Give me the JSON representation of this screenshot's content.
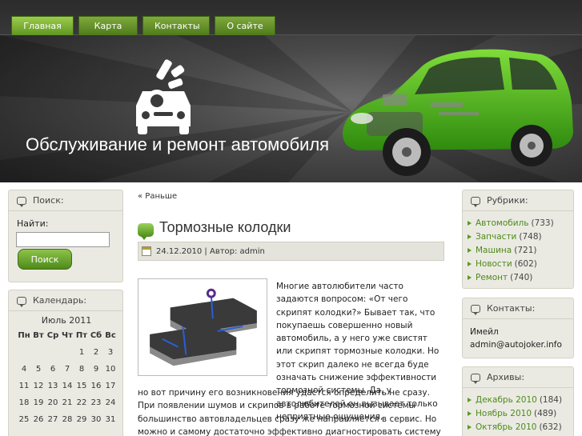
{
  "nav": {
    "items": [
      {
        "label": "Главная"
      },
      {
        "label": "Карта"
      },
      {
        "label": "Контакты"
      },
      {
        "label": "О сайте"
      }
    ]
  },
  "header": {
    "site_title": "Обслуживание и ремонт автомобиля"
  },
  "sidebar_left": {
    "search": {
      "title": "Поиск:",
      "label": "Найти:",
      "input_value": "",
      "button_label": "Поиск"
    },
    "calendar": {
      "title": "Календарь:",
      "month": "Июль 2011",
      "weekdays": [
        "Пн",
        "Вт",
        "Ср",
        "Чт",
        "Пт",
        "Сб",
        "Вс"
      ],
      "weeks": [
        [
          "",
          "",
          "",
          "",
          "1",
          "2",
          "3"
        ],
        [
          "4",
          "5",
          "6",
          "7",
          "8",
          "9",
          "10"
        ],
        [
          "11",
          "12",
          "13",
          "14",
          "15",
          "16",
          "17"
        ],
        [
          "18",
          "19",
          "20",
          "21",
          "22",
          "23",
          "24"
        ],
        [
          "25",
          "26",
          "27",
          "28",
          "29",
          "30",
          "31"
        ]
      ]
    }
  },
  "main": {
    "prev_link": "« Раньше",
    "post": {
      "title": "Тормозные колодки",
      "meta": "24.12.2010 | Автор: admin",
      "text_right": "Многие автолюбители часто задаются вопросом: «От чего скрипят колодки?» Бывает так, что покупаешь совершенно новый автомобиль, а у него уже свистят или скрипят тормозные колодки. Но этот скрип далеко не всегда буде означать снижение эффективности тормозной системы. Да, у автолюбителей он вызывает только неприятные ощущения,",
      "text_full": "но вот причину его возникновения удастся определить не сразу. При появлении шумов и скрипов в работе тормозной системы большинство автовладельцев сразу же направляется в сервис. Но можно и самому достаточно эффективно диагностировать систему тормозов и распознать"
    }
  },
  "sidebar_right": {
    "rubrics": {
      "title": "Рубрики:",
      "items": [
        {
          "label": "Автомобиль",
          "count": "(733)"
        },
        {
          "label": "Запчасти",
          "count": "(748)"
        },
        {
          "label": "Машина",
          "count": "(721)"
        },
        {
          "label": "Новости",
          "count": "(602)"
        },
        {
          "label": "Ремонт",
          "count": "(740)"
        }
      ]
    },
    "contacts": {
      "title": "Контакты:",
      "line1": "Имейл",
      "line2": "admin@autojoker.info"
    },
    "archives": {
      "title": "Архивы:",
      "items": [
        {
          "label": "Декабрь 2010",
          "count": "(184)"
        },
        {
          "label": "Ноябрь 2010",
          "count": "(489)"
        },
        {
          "label": "Октябрь 2010",
          "count": "(632)"
        }
      ]
    }
  },
  "colors": {
    "accent_green": "#5a9a1e",
    "header_dark": "#2e2e2e",
    "widget_bg": "#eaeae3"
  }
}
